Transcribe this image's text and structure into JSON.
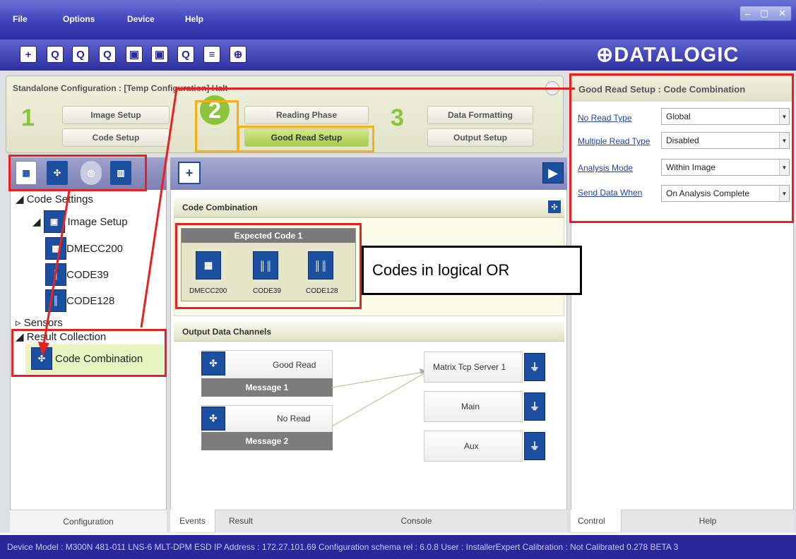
{
  "menu": {
    "file": "File",
    "options": "Options",
    "device": "Device",
    "help": "Help"
  },
  "window_controls": {
    "minimize": "–",
    "maximize": "▢",
    "close": "✕"
  },
  "toolbar_icons": [
    "new-icon",
    "connect-icon",
    "disconnect-icon",
    "open-icon",
    "save-icon",
    "device-icon",
    "export-icon",
    "settings-icon",
    "target-icon"
  ],
  "brand": "⊕DATALOGIC",
  "config": {
    "title": "Standalone Configuration :  [Temp Configuration]  Halt"
  },
  "steps": {
    "n1": "1",
    "n2": "2",
    "n3": "3",
    "image_setup": "Image Setup",
    "code_setup": "Code Setup",
    "reading_phase": "Reading Phase",
    "good_read_setup": "Good Read Setup",
    "data_formatting": "Data Formatting",
    "output_setup": "Output Setup"
  },
  "tree": {
    "code_settings": "Code Settings",
    "image_setup": "Image Setup",
    "dmecc200": "DMECC200",
    "code39": "CODE39",
    "code128": "CODE128",
    "sensors": "Sensors",
    "result_collection": "Result Collection",
    "code_combination": "Code Combination"
  },
  "left_tab": "Configuration",
  "center": {
    "combo_title": "Code Combination",
    "expected_title": "Expected Code 1",
    "codes": [
      "DMECC200",
      "CODE39",
      "CODE128"
    ],
    "output_title": "Output Data Channels",
    "events": [
      {
        "label": "Good Read",
        "message": "Message 1"
      },
      {
        "label": "No Read",
        "message": "Message 2"
      }
    ],
    "channels": [
      "Matrix Tcp Server 1",
      "Main",
      "Aux"
    ]
  },
  "bottom_tabs": {
    "events": "Events",
    "result": "Result",
    "console": "Console"
  },
  "right": {
    "title": "Good Read Setup :  Code Combination",
    "params": [
      {
        "label": "No Read Type",
        "value": "Global"
      },
      {
        "label": "Multiple Read Type",
        "value": "Disabled"
      },
      {
        "label": "Analysis Mode",
        "value": "Within Image"
      },
      {
        "label": "Send Data When",
        "value": "On Analysis Complete"
      }
    ],
    "tab_control": "Control",
    "tab_help": "Help"
  },
  "callout": "Codes in logical OR",
  "status": "Device Model : M300N   481-011   LNS-6 MLT-DPM ESD   IP Address :  172.27.101.69   Configuration schema rel :  6.0.8   User : InstallerExpert   Calibration : Not Calibrated 0.278 BETA 3",
  "colors": {
    "accent_green": "#8cc43e",
    "brand_blue": "#1d4fa0",
    "annotation_red": "#e82020",
    "annotation_orange": "#f5b019"
  }
}
